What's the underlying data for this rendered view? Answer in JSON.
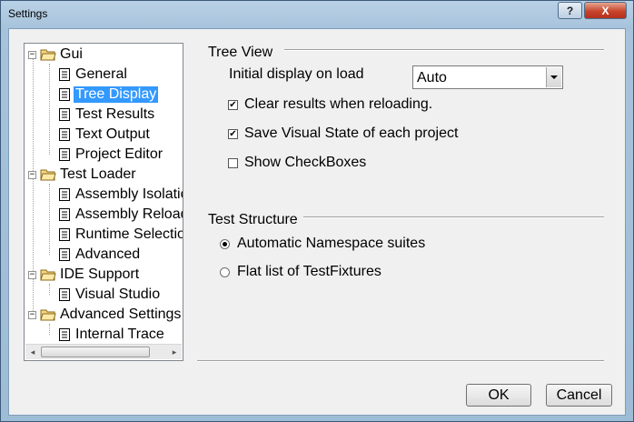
{
  "window": {
    "title": "Settings"
  },
  "titlebar": {
    "help_glyph": "?",
    "close_glyph": "X"
  },
  "tree": {
    "items": [
      {
        "label": "Gui",
        "type": "folder",
        "expanded": true,
        "expander": "−"
      },
      {
        "label": "General",
        "type": "page"
      },
      {
        "label": "Tree Display",
        "type": "page",
        "selected": true
      },
      {
        "label": "Test Results",
        "type": "page"
      },
      {
        "label": "Text Output",
        "type": "page"
      },
      {
        "label": "Project Editor",
        "type": "page"
      },
      {
        "label": "Test Loader",
        "type": "folder",
        "expanded": true,
        "expander": "−"
      },
      {
        "label": "Assembly Isolatio",
        "type": "page"
      },
      {
        "label": "Assembly Reload",
        "type": "page"
      },
      {
        "label": "Runtime Selection",
        "type": "page"
      },
      {
        "label": "Advanced",
        "type": "page"
      },
      {
        "label": "IDE Support",
        "type": "folder",
        "expanded": true,
        "expander": "−"
      },
      {
        "label": "Visual Studio",
        "type": "page"
      },
      {
        "label": "Advanced Settings",
        "type": "folder",
        "expanded": true,
        "expander": "−"
      },
      {
        "label": "Internal Trace",
        "type": "page"
      }
    ],
    "scroll_left": "◂",
    "scroll_right": "▸"
  },
  "tree_view": {
    "title": "Tree View",
    "initial_display_label": "Initial display on load",
    "initial_display_value": "Auto",
    "clear_results": {
      "label": "Clear results when reloading.",
      "checked": true,
      "mark": "✔"
    },
    "save_visual_state": {
      "label": "Save Visual State of each project",
      "checked": true,
      "mark": "✔"
    },
    "show_checkboxes": {
      "label": "Show CheckBoxes",
      "checked": false,
      "mark": ""
    }
  },
  "test_structure": {
    "title": "Test Structure",
    "automatic_namespace": {
      "label": "Automatic Namespace suites",
      "selected": true
    },
    "flat_list": {
      "label": "Flat list of TestFixtures",
      "selected": false
    }
  },
  "buttons": {
    "ok": "OK",
    "cancel": "Cancel"
  },
  "colors": {
    "selection": "#3399ff",
    "window_frame": "#a7c3db",
    "close_button": "#c7452b"
  }
}
